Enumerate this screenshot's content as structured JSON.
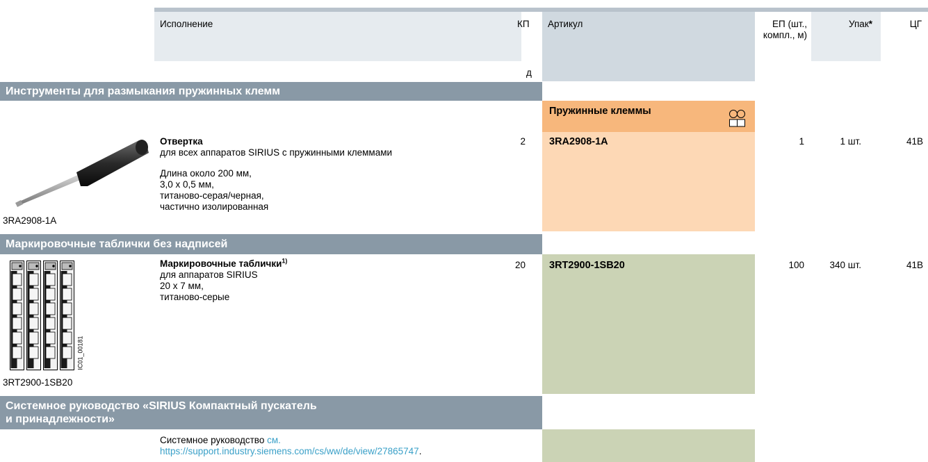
{
  "header": {
    "col_description": "Исполнение",
    "col_kp": "КП",
    "col_kp_sub": "д",
    "col_article": "Артикул",
    "col_ep": "ЕП (шт., компл., м)",
    "col_pack": "Упак",
    "col_pack_star": "*",
    "col_pg": "ЦГ"
  },
  "sections": {
    "tools_title": "Инструменты для размыкания пружинных клемм",
    "labels_title": "Маркировочные таблички без надписей",
    "manual_title_line1": "Системное руководство «SIRIUS Компактный пускатель",
    "manual_title_line2": "и принадлежности»"
  },
  "screwdriver": {
    "subheader": "Пружинные клеммы",
    "subheader_icon": "spring-terminal-icon",
    "name": "Отвертка",
    "line1": "для всех аппаратов SIRIUS с пружинными клеммами",
    "line2": "Длина около 200 мм,",
    "line3": "3,0 x 0,5 мм,",
    "line4": "титаново-серая/черная,",
    "line5": "частично изолированная",
    "kp": "2",
    "article": "3RA2908-1A",
    "ep": "1",
    "pack": "1 шт.",
    "pg": "41B",
    "image_caption": "3RA2908-1A",
    "image_icon": "screwdriver-icon"
  },
  "labels": {
    "name": "Маркировочные таблички",
    "footnote": "1)",
    "line1": "для аппаратов SIRIUS",
    "line2": "20 x 7 мм,",
    "line3": "титаново-серые",
    "kp": "20",
    "article": "3RT2900-1SB20",
    "ep": "100",
    "pack": "340 шт.",
    "pg": "41B",
    "image_caption": "3RT2900-1SB20",
    "image_code": "IC01_00181",
    "image_icon": "marking-labels-icon"
  },
  "manual": {
    "text": "Системное руководство",
    "see": "см.",
    "url": "https://support.industry.siemens.com/cs/ww/de/view/27865747",
    "url_tail": "."
  },
  "colors": {
    "section_bg": "#8999a6",
    "header_bg": "#e6ebef",
    "article_header_bg": "#d0d9e0",
    "orange_header": "#f7b77c",
    "orange_light": "#fdd8b5",
    "green": "#cbd3b5",
    "link": "#3aa0c8"
  }
}
